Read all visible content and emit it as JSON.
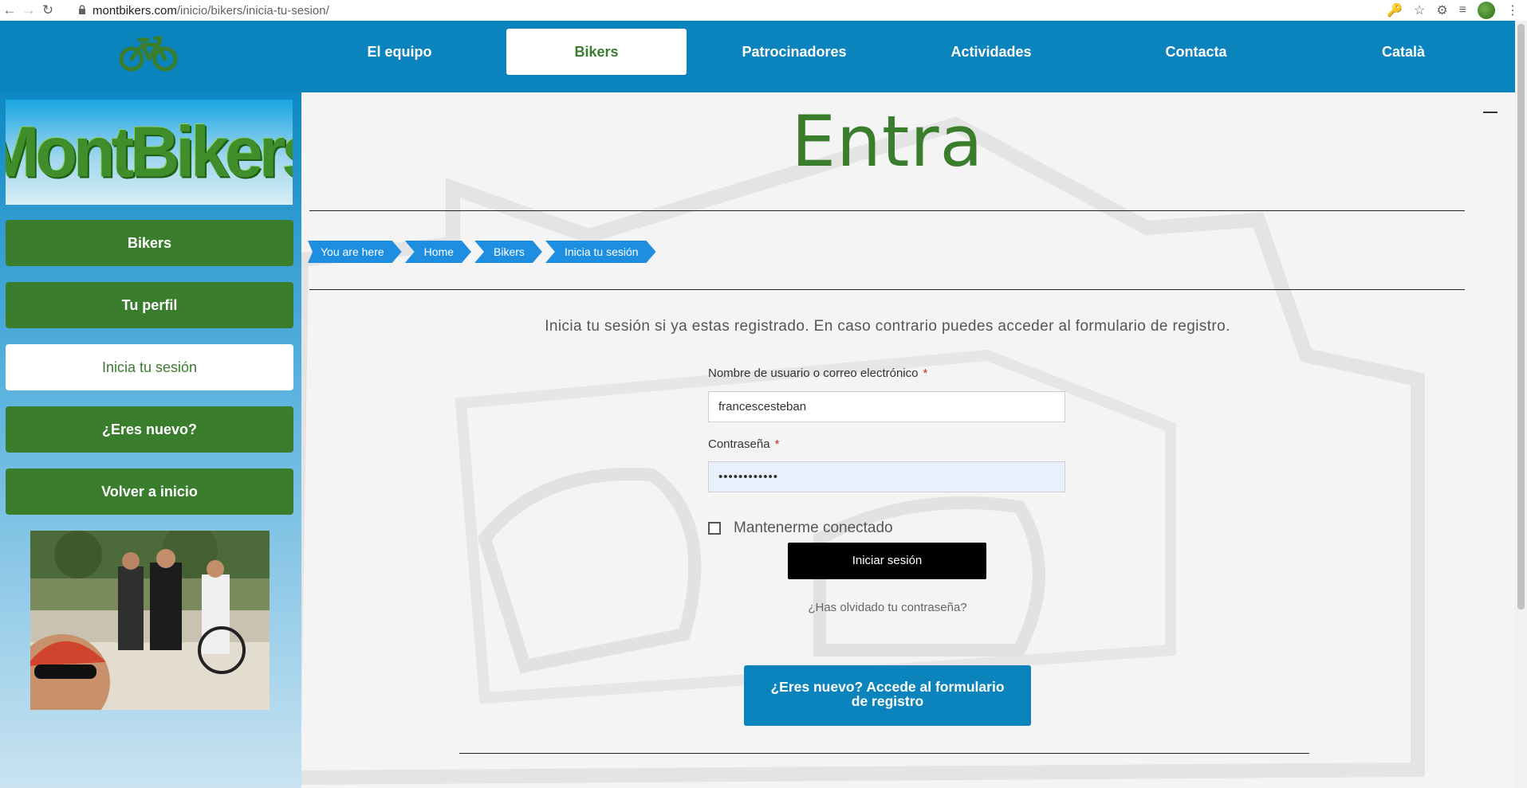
{
  "browser": {
    "url_host": "montbikers.com",
    "url_path": "/inicio/bikers/inicia-tu-sesion/"
  },
  "topnav": {
    "items": [
      {
        "label": "El equipo",
        "active": false
      },
      {
        "label": "Bikers",
        "active": true
      },
      {
        "label": "Patrocinadores",
        "active": false
      },
      {
        "label": "Actividades",
        "active": false
      },
      {
        "label": "Contacta",
        "active": false
      },
      {
        "label": "Català",
        "active": false
      }
    ]
  },
  "sidebar": {
    "brand": "MontBikers",
    "items": [
      {
        "label": "Bikers",
        "active": false
      },
      {
        "label": "Tu perfil",
        "active": false
      },
      {
        "label": "Inicia tu sesión",
        "active": true
      },
      {
        "label": "¿Eres nuevo?",
        "active": false
      },
      {
        "label": "Volver a inicio",
        "active": false
      }
    ]
  },
  "main": {
    "title": "Entra",
    "breadcrumb": [
      "You are here",
      "Home",
      "Bikers",
      "Inicia tu sesión"
    ],
    "intro": "Inicia tu sesión si ya estas registrado. En caso contrario puedes acceder al formulario de registro.",
    "form": {
      "username_label": "Nombre de usuario o correo electrónico",
      "username_value": "francescesteban",
      "password_label": "Contraseña",
      "password_value": "••••••••••••",
      "required_mark": "*",
      "remember_label": "Mantenerme conectado",
      "submit_label": "Iniciar sesión",
      "forgot_label": "¿Has olvidado tu contraseña?",
      "register_label": "¿Eres nuevo? Accede al formulario de registro"
    }
  },
  "colors": {
    "primary_blue": "#0b83bd",
    "brand_green": "#3a7d2c",
    "crumb_blue": "#1e8fe0"
  }
}
